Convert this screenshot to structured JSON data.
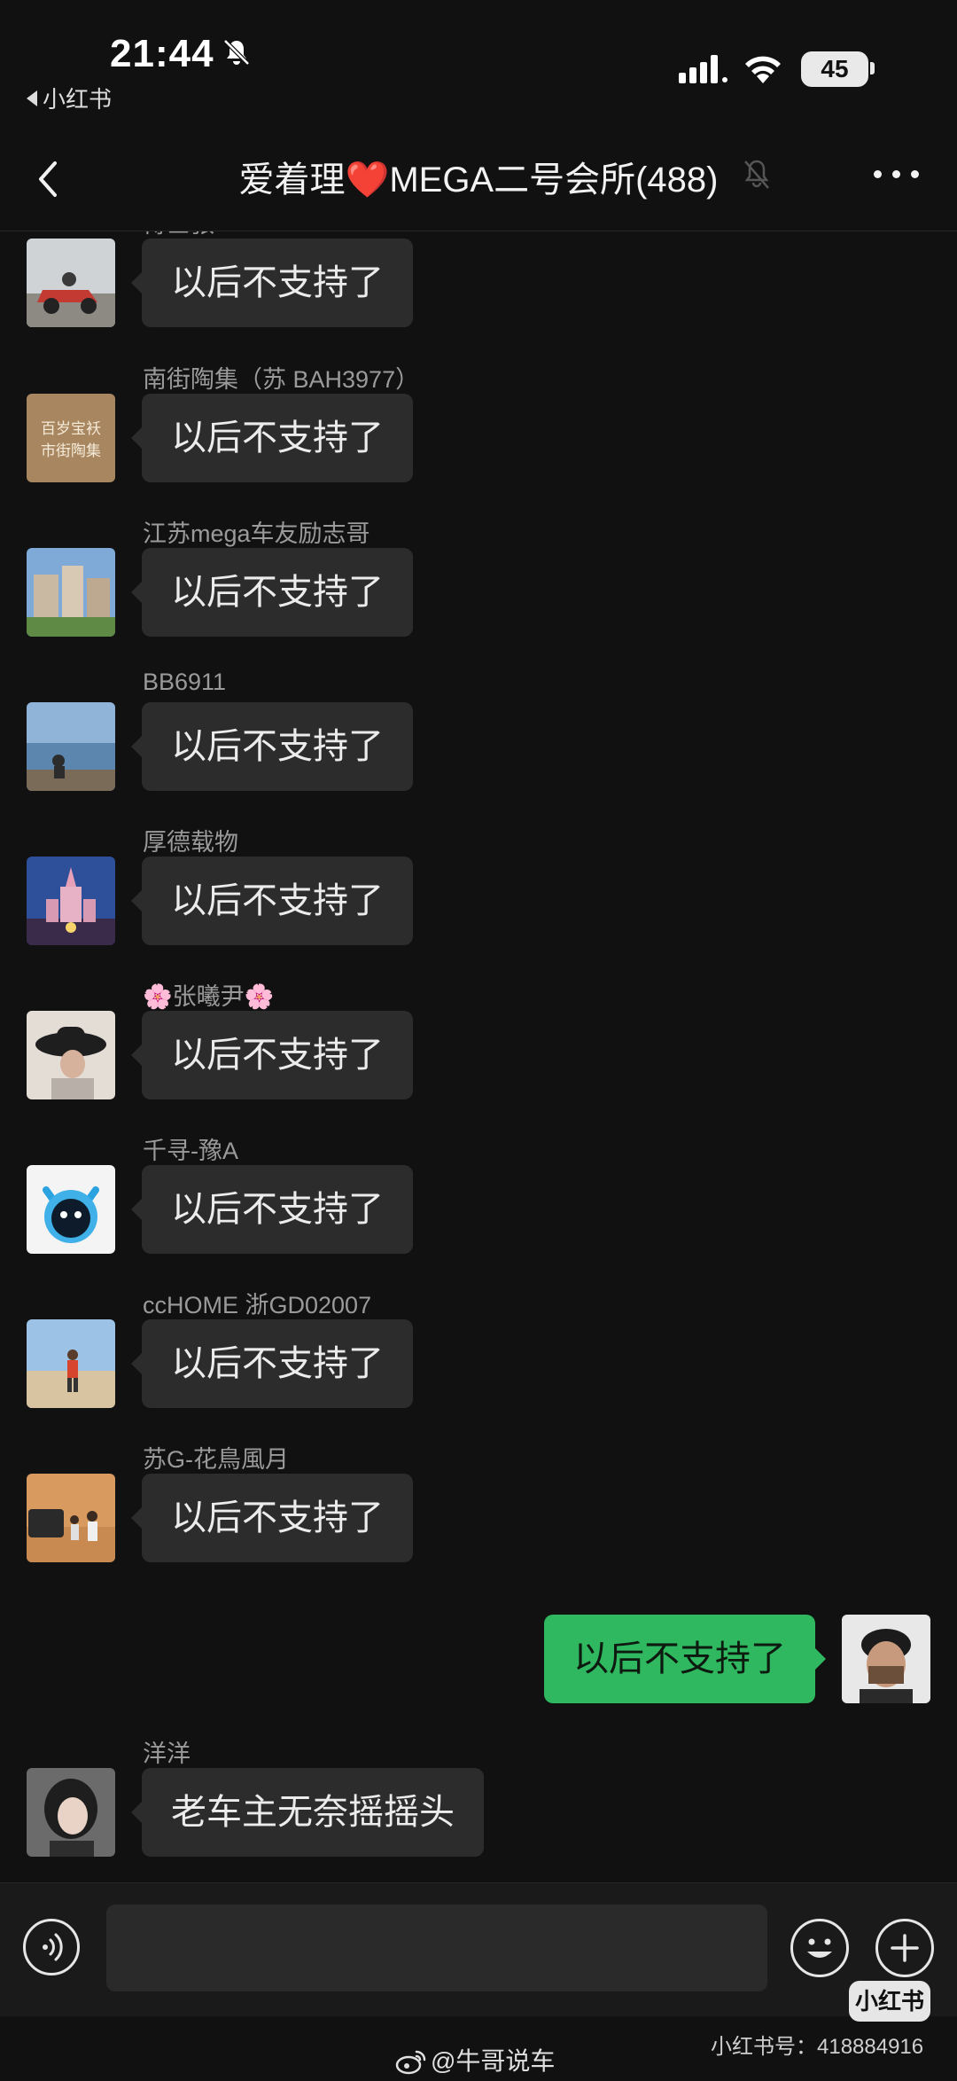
{
  "status_bar": {
    "time": "21:44",
    "back_app": "小红书",
    "battery": "45"
  },
  "nav": {
    "title_prefix": "爱着理",
    "title_heart": "❤️",
    "title_suffix": "MEGA二号会所(488)"
  },
  "messages": [
    {
      "sender": "博士张",
      "text": "以后不支持了",
      "self": false
    },
    {
      "sender": "南街陶集（苏 BAH3977）",
      "text": "以后不支持了",
      "self": false
    },
    {
      "sender": "江苏mega车友励志哥",
      "text": "以后不支持了",
      "self": false
    },
    {
      "sender": "BB6911",
      "text": "以后不支持了",
      "self": false
    },
    {
      "sender": "厚德载物",
      "text": "以后不支持了",
      "self": false
    },
    {
      "sender": "🌸张曦尹🌸",
      "text": "以后不支持了",
      "self": false
    },
    {
      "sender": "千寻-豫A",
      "text": "以后不支持了",
      "self": false
    },
    {
      "sender": "ccHOME 浙GD02007",
      "text": "以后不支持了",
      "self": false
    },
    {
      "sender": "苏G-花鳥風月",
      "text": "以后不支持了",
      "self": false
    },
    {
      "sender": "",
      "text": "以后不支持了",
      "self": true
    },
    {
      "sender": "洋洋",
      "text": "老车主无奈摇摇头",
      "self": false
    }
  ],
  "avatar_text": {
    "nanjie_line1": "百岁宝袄",
    "nanjie_line2": "市街陶集"
  },
  "input": {
    "placeholder": ""
  },
  "watermark": {
    "badge": "小红书",
    "id": "小红书号：418884916",
    "weibo": "@牛哥说车"
  }
}
